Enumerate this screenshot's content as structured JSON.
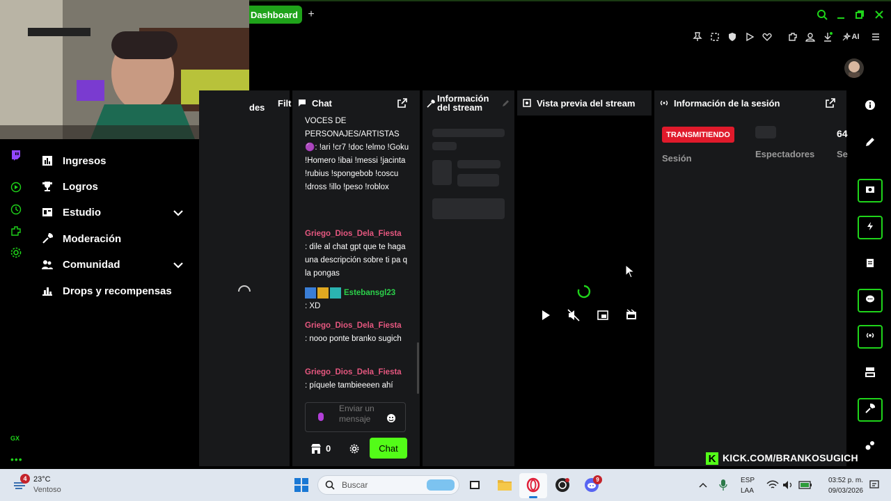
{
  "browser": {
    "tab_label": "Dashboard",
    "new_tab_symbol": "+",
    "ai_label": "AI"
  },
  "sidebar": {
    "items": [
      {
        "label": "Ingresos",
        "icon": "chart-icon"
      },
      {
        "label": "Logros",
        "icon": "trophy-icon"
      },
      {
        "label": "Estudio",
        "icon": "studio-icon",
        "expandable": true
      },
      {
        "label": "Moderación",
        "icon": "wrench-icon"
      },
      {
        "label": "Comunidad",
        "icon": "community-icon",
        "expandable": true
      },
      {
        "label": "Drops y recompensas",
        "icon": "drops-icon"
      }
    ],
    "gx_label": "GX"
  },
  "partial_panel": {
    "text_a": "des",
    "text_b": "Filt"
  },
  "chat": {
    "title": "Chat",
    "messages": [
      {
        "user": "",
        "text": "VOCES DE PERSONAJES/ARTISTAS 🟣: !ari !cr7 !doc !elmo !Goku !Homero !ibai !messi !jacinta !rubius !spongebob !coscu !dross !illo !peso !roblox"
      },
      {
        "user": "Griego_Dios_Dela_Fiesta",
        "text": ": dile al chat gpt que te haga una descripción sobre ti pa q la pongas"
      },
      {
        "user": "Estebansgl23",
        "text": ": XD"
      },
      {
        "user": "Griego_Dios_Dela_Fiesta",
        "text": ": nooo ponte branko sugich"
      },
      {
        "user": "Griego_Dios_Dela_Fiesta",
        "text": ": píquele tambieeeen ahí"
      }
    ],
    "input_placeholder": "Enviar un mensaje",
    "points_count": "0",
    "send_label": "Chat"
  },
  "stream_info": {
    "title": "Información del stream"
  },
  "preview": {
    "title": "Vista previa del stream"
  },
  "session": {
    "title": "Información de la sesión",
    "live_badge": "TRANSMITIENDO",
    "session_label": "Sesión",
    "viewers_label": "Espectadores",
    "third_value": "64",
    "third_label": "Se"
  },
  "overlay": {
    "kick_url": "KICK.COM/BRANKOSUGICH"
  },
  "taskbar": {
    "weather_temp": "23°C",
    "weather_desc": "Ventoso",
    "weather_badge": "4",
    "search_placeholder": "Buscar",
    "discord_badge": "9",
    "lang_line1": "ESP",
    "lang_line2": "LAA",
    "time": "03:52 p. m.",
    "date": "09/03/2026"
  },
  "colors": {
    "accent": "#1fd41a",
    "kick_green": "#53fc18",
    "live_red": "#e01a2b",
    "pink_user": "#e5577f",
    "green_user": "#2bd14a"
  }
}
